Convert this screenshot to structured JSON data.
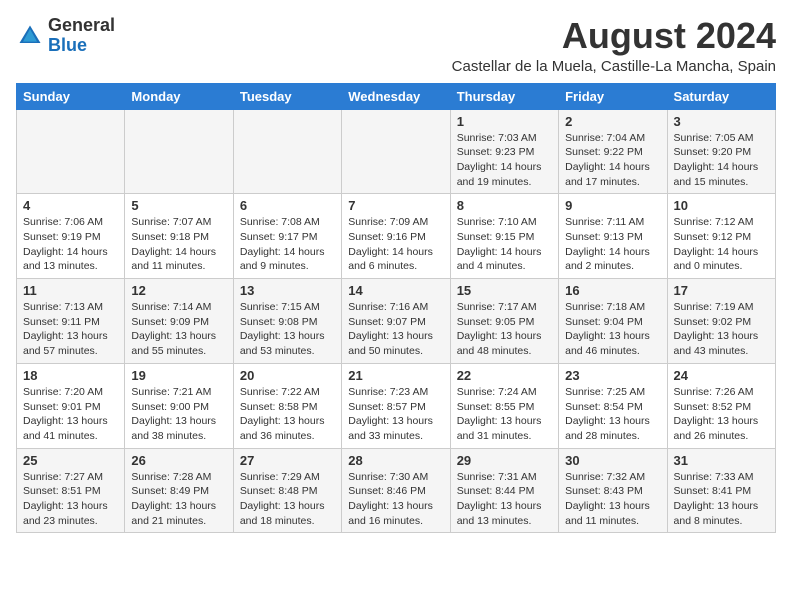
{
  "header": {
    "logo_general": "General",
    "logo_blue": "Blue",
    "title": "August 2024",
    "subtitle": "Castellar de la Muela, Castille-La Mancha, Spain"
  },
  "calendar": {
    "days_of_week": [
      "Sunday",
      "Monday",
      "Tuesday",
      "Wednesday",
      "Thursday",
      "Friday",
      "Saturday"
    ],
    "weeks": [
      [
        {
          "day": "",
          "info": ""
        },
        {
          "day": "",
          "info": ""
        },
        {
          "day": "",
          "info": ""
        },
        {
          "day": "",
          "info": ""
        },
        {
          "day": "1",
          "info": "Sunrise: 7:03 AM\nSunset: 9:23 PM\nDaylight: 14 hours\nand 19 minutes."
        },
        {
          "day": "2",
          "info": "Sunrise: 7:04 AM\nSunset: 9:22 PM\nDaylight: 14 hours\nand 17 minutes."
        },
        {
          "day": "3",
          "info": "Sunrise: 7:05 AM\nSunset: 9:20 PM\nDaylight: 14 hours\nand 15 minutes."
        }
      ],
      [
        {
          "day": "4",
          "info": "Sunrise: 7:06 AM\nSunset: 9:19 PM\nDaylight: 14 hours\nand 13 minutes."
        },
        {
          "day": "5",
          "info": "Sunrise: 7:07 AM\nSunset: 9:18 PM\nDaylight: 14 hours\nand 11 minutes."
        },
        {
          "day": "6",
          "info": "Sunrise: 7:08 AM\nSunset: 9:17 PM\nDaylight: 14 hours\nand 9 minutes."
        },
        {
          "day": "7",
          "info": "Sunrise: 7:09 AM\nSunset: 9:16 PM\nDaylight: 14 hours\nand 6 minutes."
        },
        {
          "day": "8",
          "info": "Sunrise: 7:10 AM\nSunset: 9:15 PM\nDaylight: 14 hours\nand 4 minutes."
        },
        {
          "day": "9",
          "info": "Sunrise: 7:11 AM\nSunset: 9:13 PM\nDaylight: 14 hours\nand 2 minutes."
        },
        {
          "day": "10",
          "info": "Sunrise: 7:12 AM\nSunset: 9:12 PM\nDaylight: 14 hours\nand 0 minutes."
        }
      ],
      [
        {
          "day": "11",
          "info": "Sunrise: 7:13 AM\nSunset: 9:11 PM\nDaylight: 13 hours\nand 57 minutes."
        },
        {
          "day": "12",
          "info": "Sunrise: 7:14 AM\nSunset: 9:09 PM\nDaylight: 13 hours\nand 55 minutes."
        },
        {
          "day": "13",
          "info": "Sunrise: 7:15 AM\nSunset: 9:08 PM\nDaylight: 13 hours\nand 53 minutes."
        },
        {
          "day": "14",
          "info": "Sunrise: 7:16 AM\nSunset: 9:07 PM\nDaylight: 13 hours\nand 50 minutes."
        },
        {
          "day": "15",
          "info": "Sunrise: 7:17 AM\nSunset: 9:05 PM\nDaylight: 13 hours\nand 48 minutes."
        },
        {
          "day": "16",
          "info": "Sunrise: 7:18 AM\nSunset: 9:04 PM\nDaylight: 13 hours\nand 46 minutes."
        },
        {
          "day": "17",
          "info": "Sunrise: 7:19 AM\nSunset: 9:02 PM\nDaylight: 13 hours\nand 43 minutes."
        }
      ],
      [
        {
          "day": "18",
          "info": "Sunrise: 7:20 AM\nSunset: 9:01 PM\nDaylight: 13 hours\nand 41 minutes."
        },
        {
          "day": "19",
          "info": "Sunrise: 7:21 AM\nSunset: 9:00 PM\nDaylight: 13 hours\nand 38 minutes."
        },
        {
          "day": "20",
          "info": "Sunrise: 7:22 AM\nSunset: 8:58 PM\nDaylight: 13 hours\nand 36 minutes."
        },
        {
          "day": "21",
          "info": "Sunrise: 7:23 AM\nSunset: 8:57 PM\nDaylight: 13 hours\nand 33 minutes."
        },
        {
          "day": "22",
          "info": "Sunrise: 7:24 AM\nSunset: 8:55 PM\nDaylight: 13 hours\nand 31 minutes."
        },
        {
          "day": "23",
          "info": "Sunrise: 7:25 AM\nSunset: 8:54 PM\nDaylight: 13 hours\nand 28 minutes."
        },
        {
          "day": "24",
          "info": "Sunrise: 7:26 AM\nSunset: 8:52 PM\nDaylight: 13 hours\nand 26 minutes."
        }
      ],
      [
        {
          "day": "25",
          "info": "Sunrise: 7:27 AM\nSunset: 8:51 PM\nDaylight: 13 hours\nand 23 minutes."
        },
        {
          "day": "26",
          "info": "Sunrise: 7:28 AM\nSunset: 8:49 PM\nDaylight: 13 hours\nand 21 minutes."
        },
        {
          "day": "27",
          "info": "Sunrise: 7:29 AM\nSunset: 8:48 PM\nDaylight: 13 hours\nand 18 minutes."
        },
        {
          "day": "28",
          "info": "Sunrise: 7:30 AM\nSunset: 8:46 PM\nDaylight: 13 hours\nand 16 minutes."
        },
        {
          "day": "29",
          "info": "Sunrise: 7:31 AM\nSunset: 8:44 PM\nDaylight: 13 hours\nand 13 minutes."
        },
        {
          "day": "30",
          "info": "Sunrise: 7:32 AM\nSunset: 8:43 PM\nDaylight: 13 hours\nand 11 minutes."
        },
        {
          "day": "31",
          "info": "Sunrise: 7:33 AM\nSunset: 8:41 PM\nDaylight: 13 hours\nand 8 minutes."
        }
      ]
    ]
  }
}
